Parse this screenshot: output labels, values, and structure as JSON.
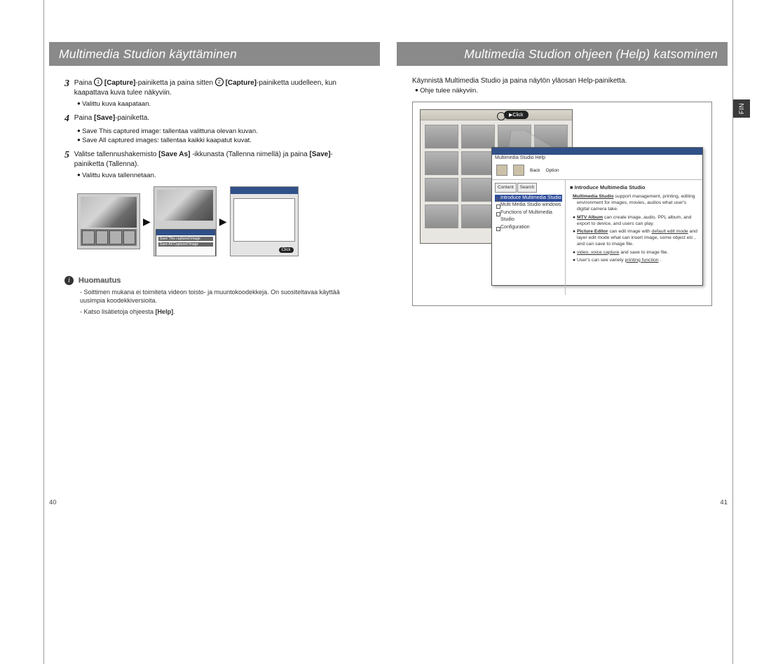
{
  "left": {
    "title": "Multimedia Studion käyttäminen",
    "step3": {
      "num": "3",
      "pre": "Paina ",
      "circ1": "1",
      "cap1": "[Capture]",
      "mid": "-painiketta ja paina sitten ",
      "circ2": "2",
      "cap2": "[Capture]",
      "post": "-painiketta uudelleen, kun kaapattava kuva tulee näkyviin.",
      "bullet": "Valittu kuva kaapataan."
    },
    "step4": {
      "num": "4",
      "text_pre": "Paina ",
      "bold": "[Save]",
      "text_post": "-painiketta.",
      "b1": "Save This captured image: tallentaa valittuna olevan kuvan.",
      "b2": "Save All captured images: tallentaa kaikki kaapatut kuvat."
    },
    "step5": {
      "num": "5",
      "pre": "Valitse tallennushakemisto ",
      "bold1": "[Save As]",
      "mid": " -ikkunasta (Tallenna nimellä) ja paina ",
      "bold2": "[Save]",
      "post": "-painiketta (Tallenna).",
      "bullet": "Valittu kuva tallennetaan."
    },
    "popup_line1": "Save This captured image",
    "popup_line2": "Save All Captured Image",
    "click_label": "Click",
    "note_title": "Huomautus",
    "note_line1": "- Soittimen mukana ei toimiteta videon toisto- ja muuntokoodekkeja. On suositeltavaa käyttää uusimpia koodekkiversioita.",
    "note_line2_pre": "- Katso lisätietoja ohjeesta ",
    "note_line2_bold": "[Help]",
    "note_line2_post": ".",
    "page_num": "40"
  },
  "right": {
    "title": "Multimedia Studion ohjeen (Help) katsominen",
    "intro": "Käynnistä Multimedia Studio ja paina näytön yläosan Help-painiketta.",
    "bullet": "Ohje tulee näkyviin.",
    "tab": "FIN",
    "click_label": "Click",
    "help": {
      "win_title": "Multimedia Studio Help",
      "tb_back": "Back",
      "tb_option": "Option",
      "tab_content": "Content",
      "tab_search": "Search",
      "tree1": "Introduce Multimedia Studio",
      "tree2": "Multi Media Studio windows",
      "tree3": "Functions of Multimedia Studio",
      "tree4": "Configuration",
      "body_title": "Introduce Multimedia Studio",
      "body_p1_pre": "Multimedia Studio",
      "body_p1": " support management, printing, editing environment for images, movies, audios what user's digital camera take.",
      "body_b1_pre": "MTV Album",
      "body_b1": " can create image, audio, PPL album, and export to device, and users can play.",
      "body_b2_pre": "Picture Editor",
      "body_b2_mid": " can edit image with ",
      "body_b2_u": "default edit mode",
      "body_b2_post": " and layer edit mode what can insert image, some object etc , and can save to image file.",
      "body_b3_pre": "video, voice capture",
      "body_b3": " and save to image file.",
      "body_b4_pre": "User's can see variety ",
      "body_b4_u": "printing function"
    },
    "page_num": "41"
  }
}
